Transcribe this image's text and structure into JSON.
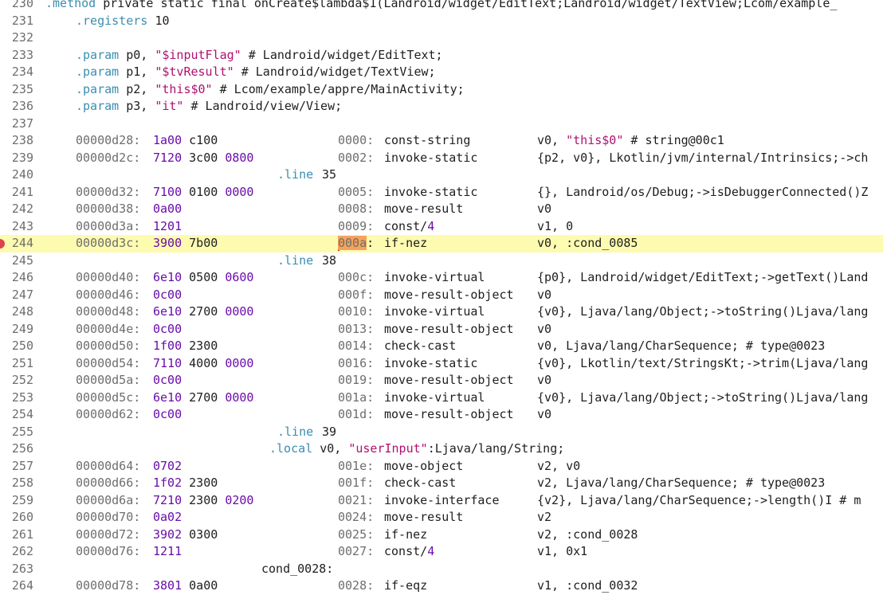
{
  "lines": [
    {
      "n": "230",
      "type": "method",
      "text": ".method private static final onCreate$lambda$1(Landroid/widget/EditText;Landroid/widget/TextView;Lcom/example_"
    },
    {
      "n": "231",
      "type": "registers",
      "kw": ".registers",
      "val": "10"
    },
    {
      "n": "232",
      "type": "blank"
    },
    {
      "n": "233",
      "type": "param",
      "kw": ".param",
      "reg": "p0,",
      "str": "\"$inputFlag\"",
      "rest": "# Landroid/widget/EditText;"
    },
    {
      "n": "234",
      "type": "param",
      "kw": ".param",
      "reg": "p1,",
      "str": "\"$tvResult\"",
      "rest": "# Landroid/widget/TextView;"
    },
    {
      "n": "235",
      "type": "param",
      "kw": ".param",
      "reg": "p2,",
      "str": "\"this$0\"",
      "rest": "# Lcom/example/appre/MainActivity;"
    },
    {
      "n": "236",
      "type": "param",
      "kw": ".param",
      "reg": "p3,",
      "str": "\"it\"",
      "rest": "# Landroid/view/View;"
    },
    {
      "n": "237",
      "type": "blank"
    },
    {
      "n": "238",
      "type": "instr",
      "addr": "00000d28:",
      "b1": "1a00",
      "b2": "c100",
      "b3": "",
      "off": "0000:",
      "op": "const-string",
      "args": "v0, ",
      "argstr": "\"this$0\"",
      "args2": " # string@00c1"
    },
    {
      "n": "239",
      "type": "instr",
      "addr": "00000d2c:",
      "b1": "7120",
      "b2": "3c00",
      "b3": "0800",
      "off": "0002:",
      "op": "invoke-static",
      "args": "{p2, v0}, Lkotlin/jvm/internal/Intrinsics;->ch"
    },
    {
      "n": "240",
      "type": "directive",
      "kw": ".line",
      "val": "35",
      "indent": "348"
    },
    {
      "n": "241",
      "type": "instr",
      "addr": "00000d32:",
      "b1": "7100",
      "b2": "0100",
      "b3": "0000",
      "off": "0005:",
      "op": "invoke-static",
      "args": "{}, Landroid/os/Debug;->isDebuggerConnected()Z"
    },
    {
      "n": "242",
      "type": "instr",
      "addr": "00000d38:",
      "b1": "0a00",
      "b2": "",
      "b3": "",
      "off": "0008:",
      "op": "move-result",
      "args": "v0"
    },
    {
      "n": "243",
      "type": "instr",
      "addr": "00000d3a:",
      "b1": "1201",
      "b2": "",
      "b3": "",
      "off": "0009:",
      "op": "const/4",
      "args": "v1, 0"
    },
    {
      "n": "244",
      "type": "instr",
      "addr": "00000d3c:",
      "b1": "3900",
      "b2": "7b00",
      "b3": "",
      "off": "000a:",
      "op": "if-nez",
      "args": "v0, :cond_0085",
      "highlight": true,
      "breakpoint": true
    },
    {
      "n": "245",
      "type": "directive",
      "kw": ".line",
      "val": "38",
      "indent": "348"
    },
    {
      "n": "246",
      "type": "instr",
      "addr": "00000d40:",
      "b1": "6e10",
      "b2": "0500",
      "b3": "0600",
      "off": "000c:",
      "op": "invoke-virtual",
      "args": "{p0}, Landroid/widget/EditText;->getText()Land"
    },
    {
      "n": "247",
      "type": "instr",
      "addr": "00000d46:",
      "b1": "0c00",
      "b2": "",
      "b3": "",
      "off": "000f:",
      "op": "move-result-object",
      "args": "v0"
    },
    {
      "n": "248",
      "type": "instr",
      "addr": "00000d48:",
      "b1": "6e10",
      "b2": "2700",
      "b3": "0000",
      "off": "0010:",
      "op": "invoke-virtual",
      "args": "{v0}, Ljava/lang/Object;->toString()Ljava/lang"
    },
    {
      "n": "249",
      "type": "instr",
      "addr": "00000d4e:",
      "b1": "0c00",
      "b2": "",
      "b3": "",
      "off": "0013:",
      "op": "move-result-object",
      "args": "v0"
    },
    {
      "n": "250",
      "type": "instr",
      "addr": "00000d50:",
      "b1": "1f00",
      "b2": "2300",
      "b3": "",
      "off": "0014:",
      "op": "check-cast",
      "args": "v0, Ljava/lang/CharSequence; # type@0023"
    },
    {
      "n": "251",
      "type": "instr",
      "addr": "00000d54:",
      "b1": "7110",
      "b2": "4000",
      "b3": "0000",
      "off": "0016:",
      "op": "invoke-static",
      "args": "{v0}, Lkotlin/text/StringsKt;->trim(Ljava/lang"
    },
    {
      "n": "252",
      "type": "instr",
      "addr": "00000d5a:",
      "b1": "0c00",
      "b2": "",
      "b3": "",
      "off": "0019:",
      "op": "move-result-object",
      "args": "v0"
    },
    {
      "n": "253",
      "type": "instr",
      "addr": "00000d5c:",
      "b1": "6e10",
      "b2": "2700",
      "b3": "0000",
      "off": "001a:",
      "op": "invoke-virtual",
      "args": "{v0}, Ljava/lang/Object;->toString()Ljava/lang"
    },
    {
      "n": "254",
      "type": "instr",
      "addr": "00000d62:",
      "b1": "0c00",
      "b2": "",
      "b3": "",
      "off": "001d:",
      "op": "move-result-object",
      "args": "v0"
    },
    {
      "n": "255",
      "type": "directive",
      "kw": ".line",
      "val": "39",
      "indent": "348"
    },
    {
      "n": "256",
      "type": "local",
      "kw": ".local",
      "reg": "v0,",
      "str": "\"userInput\"",
      "rest": ":Ljava/lang/String;",
      "indent": "338"
    },
    {
      "n": "257",
      "type": "instr",
      "addr": "00000d64:",
      "b1": "0702",
      "b2": "",
      "b3": "",
      "off": "001e:",
      "op": "move-object",
      "args": "v2, v0"
    },
    {
      "n": "258",
      "type": "instr",
      "addr": "00000d66:",
      "b1": "1f02",
      "b2": "2300",
      "b3": "",
      "off": "001f:",
      "op": "check-cast",
      "args": "v2, Ljava/lang/CharSequence; # type@0023"
    },
    {
      "n": "259",
      "type": "instr",
      "addr": "00000d6a:",
      "b1": "7210",
      "b2": "2300",
      "b3": "0200",
      "off": "0021:",
      "op": "invoke-interface",
      "args": "{v2}, Ljava/lang/CharSequence;->length()I # m"
    },
    {
      "n": "260",
      "type": "instr",
      "addr": "00000d70:",
      "b1": "0a02",
      "b2": "",
      "b3": "",
      "off": "0024:",
      "op": "move-result",
      "args": "v2"
    },
    {
      "n": "261",
      "type": "instr",
      "addr": "00000d72:",
      "b1": "3902",
      "b2": "0300",
      "b3": "",
      "off": "0025:",
      "op": "if-nez",
      "args": "v2, :cond_0028"
    },
    {
      "n": "262",
      "type": "instr",
      "addr": "00000d76:",
      "b1": "1211",
      "b2": "",
      "b3": "",
      "off": "0027:",
      "op": "const/4",
      "args": "v1, 0x1"
    },
    {
      "n": "263",
      "type": "label",
      "text": "cond_0028:",
      "indent": "328"
    },
    {
      "n": "264",
      "type": "instr",
      "addr": "00000d78:",
      "b1": "3801",
      "b2": "0a00",
      "b3": "",
      "off": "0028:",
      "op": "if-eqz",
      "args": "v1, :cond_0032"
    }
  ]
}
